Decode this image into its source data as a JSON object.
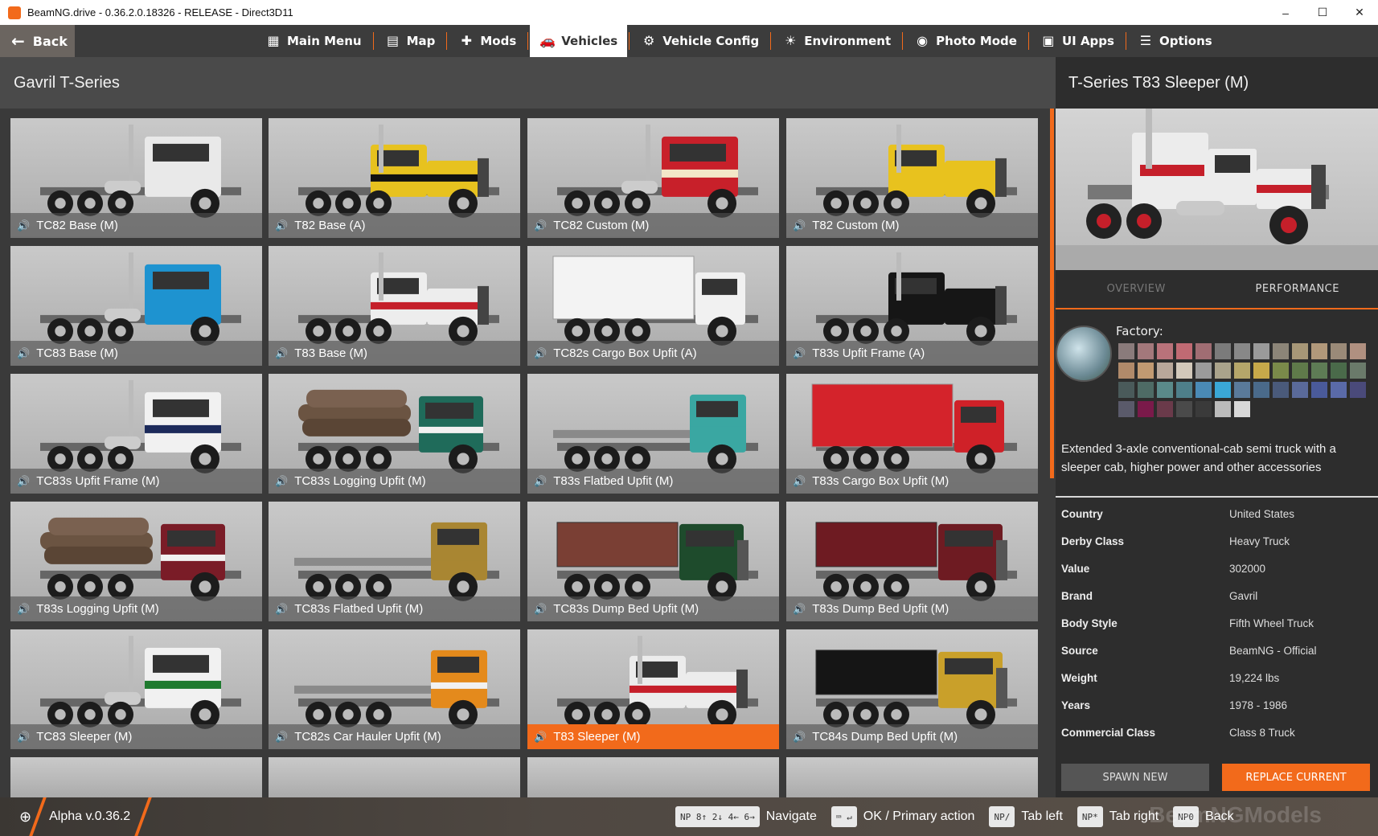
{
  "window": {
    "title": "BeamNG.drive - 0.36.2.0.18326 - RELEASE - Direct3D11",
    "minimize": "–",
    "maximize": "☐",
    "close": "✕"
  },
  "nav": {
    "back_label": "Back",
    "items": [
      {
        "label": "Main Menu",
        "icon": "main-menu-icon",
        "glyph": "▦",
        "active": false
      },
      {
        "label": "Map",
        "icon": "map-icon",
        "glyph": "▤",
        "active": false
      },
      {
        "label": "Mods",
        "icon": "mods-icon",
        "glyph": "✚",
        "active": false
      },
      {
        "label": "Vehicles",
        "icon": "car-icon",
        "glyph": "🚗",
        "active": true
      },
      {
        "label": "Vehicle Config",
        "icon": "vehicle-config-icon",
        "glyph": "⚙",
        "active": false
      },
      {
        "label": "Environment",
        "icon": "environment-icon",
        "glyph": "☀",
        "active": false
      },
      {
        "label": "Photo Mode",
        "icon": "camera-icon",
        "glyph": "◉",
        "active": false
      },
      {
        "label": "UI Apps",
        "icon": "ui-apps-icon",
        "glyph": "▣",
        "active": false
      },
      {
        "label": "Options",
        "icon": "options-icon",
        "glyph": "☰",
        "active": false
      }
    ]
  },
  "model_title": "Gavril T-Series",
  "tiles": [
    {
      "label": "TC82 Base (M)",
      "cab": "#e9e9e9",
      "trim": "#e9e9e9",
      "type": "cabover"
    },
    {
      "label": "T82 Base (A)",
      "cab": "#e7c21f",
      "trim": "#111111",
      "type": "conv"
    },
    {
      "label": "TC82 Custom (M)",
      "cab": "#c8202a",
      "trim": "#f3e7c8",
      "type": "cabover"
    },
    {
      "label": "T82 Custom (M)",
      "cab": "#e8c21e",
      "trim": "#e8c21e",
      "type": "conv"
    },
    {
      "label": "TC83 Base (M)",
      "cab": "#1e93d0",
      "trim": "#1e93d0",
      "type": "cabover"
    },
    {
      "label": "T83 Base (M)",
      "cab": "#ededed",
      "trim": "#c51f2a",
      "type": "conv"
    },
    {
      "label": "TC82s Cargo Box Upfit (A)",
      "cab": "#f1f1f1",
      "trim": "#f1f1f1",
      "type": "box"
    },
    {
      "label": "T83s Upfit Frame (A)",
      "cab": "#161616",
      "trim": "#161616",
      "type": "conv"
    },
    {
      "label": "TC83s Upfit Frame (M)",
      "cab": "#f1f1f1",
      "trim": "#1c2a5a",
      "type": "cabover"
    },
    {
      "label": "TC83s Logging Upfit (M)",
      "cab": "#1f6b5a",
      "trim": "#f1f1f1",
      "type": "log"
    },
    {
      "label": "T83s Flatbed Upfit (M)",
      "cab": "#3aa7a2",
      "trim": "#3aa7a2",
      "type": "flat"
    },
    {
      "label": "T83s Cargo Box Upfit (M)",
      "cab": "#cf2128",
      "trim": "#cf2128",
      "type": "box"
    },
    {
      "label": "T83s Logging Upfit (M)",
      "cab": "#7a1c27",
      "trim": "#f1f1f1",
      "type": "log"
    },
    {
      "label": "TC83s Flatbed Upfit (M)",
      "cab": "#a98632",
      "trim": "#a98632",
      "type": "flat"
    },
    {
      "label": "TC83s Dump Bed Upfit (M)",
      "cab": "#1e4b2c",
      "trim": "#7a3f34",
      "type": "dump"
    },
    {
      "label": "T83s Dump Bed Upfit (M)",
      "cab": "#6e1b22",
      "trim": "#6e1b22",
      "type": "dump"
    },
    {
      "label": "TC83 Sleeper (M)",
      "cab": "#f1f1f1",
      "trim": "#1e7a2e",
      "type": "cabover"
    },
    {
      "label": "TC82s Car Hauler Upfit (M)",
      "cab": "#e48a1c",
      "trim": "#f1f1f1",
      "type": "flat"
    },
    {
      "label": "T83 Sleeper (M)",
      "cab": "#ececec",
      "trim": "#c51f2a",
      "type": "conv",
      "selected": true
    },
    {
      "label": "TC84s Dump Bed Upfit (M)",
      "cab": "#c9a02a",
      "trim": "#121212",
      "type": "dump"
    }
  ],
  "details": {
    "title": "T-Series T83 Sleeper (M)",
    "tabs": [
      "OVERVIEW",
      "PERFORMANCE"
    ],
    "factory_label": "Factory:",
    "swatches": [
      "#8a7b7b",
      "#a3787b",
      "#b9727a",
      "#c06a73",
      "#a06d73",
      "#7b7b7b",
      "#888",
      "#9a9a9a",
      "#8c8578",
      "#a79777",
      "#b1987a",
      "#9a8a78",
      "#b09080",
      "#b08a6a",
      "#c19a72",
      "#b8a79a",
      "#d2c8ba",
      "#9b9b9b",
      "#aaa38b",
      "#b5a66a",
      "#c7a94a",
      "#7a8a4a",
      "#5f7a4a",
      "#5e7c55",
      "#4a6a4a",
      "#6a7a6a",
      "#4a5a5a",
      "#4e6b65",
      "#5a8a8a",
      "#4e7f8a",
      "#4a8ab5",
      "#3aa7d6",
      "#5a7a9a",
      "#4a6a8a",
      "#4a5a7a",
      "#5a6a9a",
      "#4a5a9a",
      "#5a6aa8",
      "#4a4a7a",
      "#5a5a6a",
      "#7a1a4a",
      "#6a3a4a",
      "#4a4a4a",
      "#3a3a3a",
      "#bbbbbb",
      "#d8d8d8"
    ],
    "description": "Extended 3-axle conventional-cab semi truck with a sleeper cab, higher power and other accessories",
    "specs": [
      {
        "key": "Country",
        "value": "United States"
      },
      {
        "key": "Derby Class",
        "value": "Heavy Truck"
      },
      {
        "key": "Value",
        "value": "302000"
      },
      {
        "key": "Brand",
        "value": "Gavril"
      },
      {
        "key": "Body Style",
        "value": "Fifth Wheel Truck"
      },
      {
        "key": "Source",
        "value": "BeamNG - Official"
      },
      {
        "key": "Weight",
        "value": "19,224 lbs"
      },
      {
        "key": "Years",
        "value": "1978 - 1986"
      },
      {
        "key": "Commercial Class",
        "value": "Class 8 Truck"
      }
    ],
    "spawn_label": "SPAWN NEW",
    "replace_label": "REPLACE CURRENT"
  },
  "bottom": {
    "version": "Alpha v.0.36.2",
    "hints": [
      {
        "key": "NP 8↑ 2↓ 4← 6→",
        "label": "Navigate"
      },
      {
        "key": "⌨ ↵",
        "label": "OK / Primary action"
      },
      {
        "key": "NP/",
        "label": "Tab left"
      },
      {
        "key": "NP*",
        "label": "Tab right"
      },
      {
        "key": "NP0",
        "label": "Back"
      }
    ],
    "watermark": "BeamNGModels"
  },
  "colors": {
    "accent": "#f26a1b"
  }
}
